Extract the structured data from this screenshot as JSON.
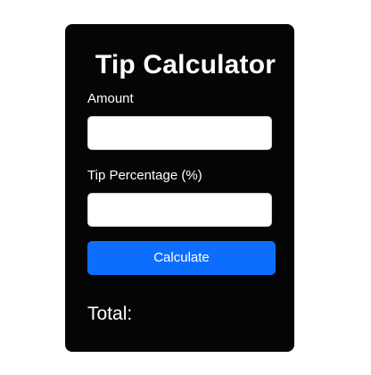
{
  "calculator": {
    "title": "Tip Calculator",
    "amount_label": "Amount",
    "amount_value": "",
    "tip_label": "Tip Percentage (%)",
    "tip_value": "",
    "calculate_label": "Calculate",
    "total_label": "Total:"
  },
  "colors": {
    "card_background": "#050505",
    "button_background": "#0d6efd",
    "text": "#ffffff"
  }
}
